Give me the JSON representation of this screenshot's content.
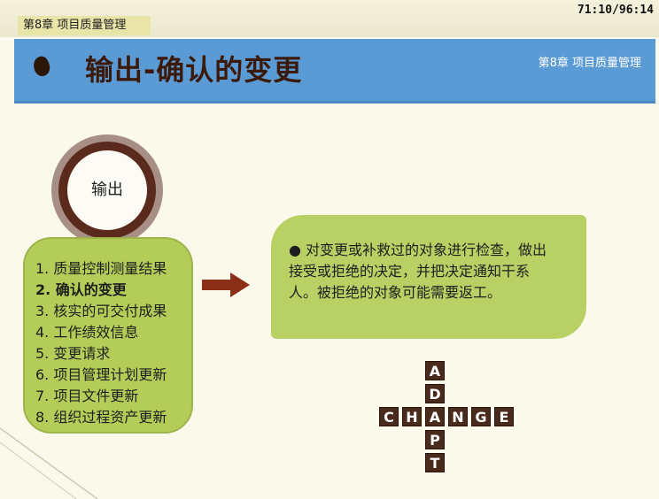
{
  "header": {
    "chapter_tag": "第8章 项目质量管理",
    "timecode": "71:10/96:14"
  },
  "title_bar": {
    "title": "输出-确认的变更",
    "chapter_label": "第8章 项目质量管理"
  },
  "ring": {
    "label": "输出"
  },
  "outputs": {
    "items": [
      "1. 质量控制测量结果",
      "2. 确认的变更",
      "3. 核实的可交付成果",
      "4. 工作绩效信息",
      "5. 变更请求",
      "6. 项目管理计划更新",
      "7. 项目文件更新",
      "8. 组织过程资产更新"
    ],
    "highlighted_index": 1
  },
  "bubble": {
    "text": "对变更或补救过的对象进行检查，做出接受或拒绝的决定，并把决定通知干系人。被拒绝的对象可能需要返工。"
  },
  "crossword": {
    "horizontal": "CHANGE",
    "vertical": "ADAPT"
  },
  "colors": {
    "title_bar": "#5b9bd5",
    "panel_green": "#b4cc58",
    "arrow": "#8b3016",
    "tile": "#4a2a1c"
  }
}
